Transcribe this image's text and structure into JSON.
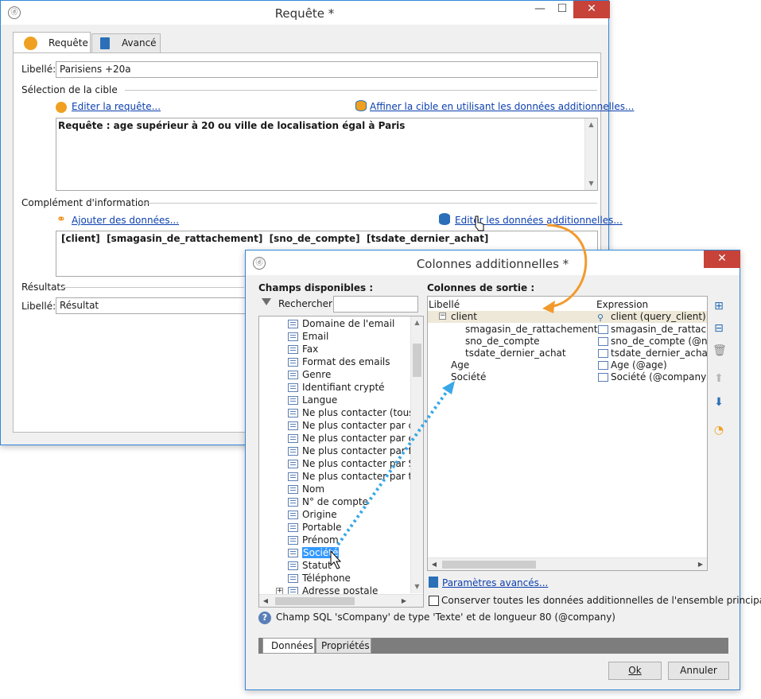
{
  "requete": {
    "title": "Requête *",
    "tabs": [
      {
        "label": "Requête"
      },
      {
        "label": "Avancé"
      }
    ],
    "libelle_label": "Libellé:",
    "libelle_value": "Parisiens +20a",
    "section_cible": "Sélection de la cible",
    "edit_query_link": "Editer la requête...",
    "refine_link": "Affiner la cible en utilisant les données additionnelles...",
    "query_text": "Requête : age supérieur à 20 ou ville de localisation égal à Paris",
    "section_complement": "Complément d'information",
    "add_data_link": "Ajouter des données...",
    "edit_data_link": "Editer les données additionnelles...",
    "fields_text": "[client]  [smagasin_de_rattachement]  [sno_de_compte]  [tsdate_dernier_achat]",
    "section_resultats": "Résultats",
    "result_label": "Libellé:",
    "result_value": "Résultat"
  },
  "colonnes": {
    "title": "Colonnes additionnelles *",
    "champs_label": "Champs disponibles :",
    "search_label": "Rechercher:",
    "search_value": "",
    "tree_items": [
      {
        "label": "Domaine de l'email"
      },
      {
        "label": "Email"
      },
      {
        "label": "Fax"
      },
      {
        "label": "Format des emails"
      },
      {
        "label": "Genre"
      },
      {
        "label": "Identifiant crypté"
      },
      {
        "label": "Langue"
      },
      {
        "label": "Ne plus contacter (tous c"
      },
      {
        "label": "Ne plus contacter par cou"
      },
      {
        "label": "Ne plus contacter par em"
      },
      {
        "label": "Ne plus contacter par fax"
      },
      {
        "label": "Ne plus contacter par SM"
      },
      {
        "label": "Ne plus contacter par télé"
      },
      {
        "label": "Nom"
      },
      {
        "label": "N° de compte"
      },
      {
        "label": "Origine"
      },
      {
        "label": "Portable"
      },
      {
        "label": "Prénom"
      },
      {
        "label": "Société"
      },
      {
        "label": "Statut"
      },
      {
        "label": "Téléphone"
      },
      {
        "label": "Adresse postale"
      }
    ],
    "sortie_label": "Colonnes de sortie :",
    "col_libelle": "Libellé",
    "col_expression": "Expression",
    "rows": [
      {
        "libelle": "client",
        "expression": "client (query_client)"
      },
      {
        "libelle": "smagasin_de_rattachement",
        "expression": "smagasin_de_rattacheme"
      },
      {
        "libelle": "sno_de_compte",
        "expression": "sno_de_compte (@no_de"
      },
      {
        "libelle": "tsdate_dernier_achat",
        "expression": "tsdate_dernier_achat (@c"
      },
      {
        "libelle": "Age",
        "expression": "Age (@age)"
      },
      {
        "libelle": "Société",
        "expression": "Société (@company)"
      }
    ],
    "params_link": "Paramètres avancés...",
    "conserver_label": "Conserver toutes les données additionnelles de l'ensemble principal",
    "info_text": "Champ SQL 'sCompany' de type 'Texte' et de longueur 80 (@company)",
    "bottom_tabs": [
      {
        "label": "Données"
      },
      {
        "label": "Propriétés"
      }
    ],
    "ok_label": "Ok",
    "cancel_label": "Annuler"
  }
}
